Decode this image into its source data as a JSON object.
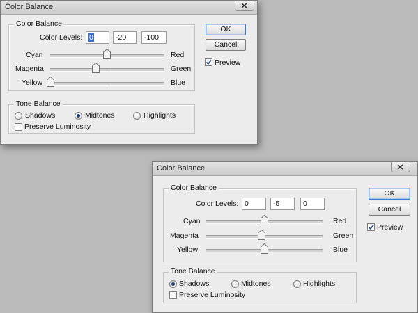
{
  "dialogs": [
    {
      "title": "Color Balance",
      "color_balance_group": "Color Balance",
      "color_levels_label": "Color Levels:",
      "levels": [
        "0",
        "-20",
        "-100"
      ],
      "level_selected": 0,
      "sliders": [
        {
          "left": "Cyan",
          "right": "Red",
          "value": 0
        },
        {
          "left": "Magenta",
          "right": "Green",
          "value": -20
        },
        {
          "left": "Yellow",
          "right": "Blue",
          "value": -100
        }
      ],
      "ok_label": "OK",
      "cancel_label": "Cancel",
      "preview_label": "Preview",
      "preview_checked": true,
      "tone_group": "Tone Balance",
      "tones": [
        "Shadows",
        "Midtones",
        "Highlights"
      ],
      "tone_selected": 1,
      "preserve_label": "Preserve Luminosity",
      "preserve_checked": false
    },
    {
      "title": "Color Balance",
      "color_balance_group": "Color Balance",
      "color_levels_label": "Color Levels:",
      "levels": [
        "0",
        "-5",
        "0"
      ],
      "level_selected": -1,
      "sliders": [
        {
          "left": "Cyan",
          "right": "Red",
          "value": 0
        },
        {
          "left": "Magenta",
          "right": "Green",
          "value": -5
        },
        {
          "left": "Yellow",
          "right": "Blue",
          "value": 0
        }
      ],
      "ok_label": "OK",
      "cancel_label": "Cancel",
      "preview_label": "Preview",
      "preview_checked": true,
      "tone_group": "Tone Balance",
      "tones": [
        "Shadows",
        "Midtones",
        "Highlights"
      ],
      "tone_selected": 0,
      "preserve_label": "Preserve Luminosity",
      "preserve_checked": false
    }
  ],
  "slider_range": [
    -100,
    100
  ],
  "colors": {
    "desktop": "#bababa",
    "dialog": "#ececec",
    "accent": "#3a78d6"
  }
}
